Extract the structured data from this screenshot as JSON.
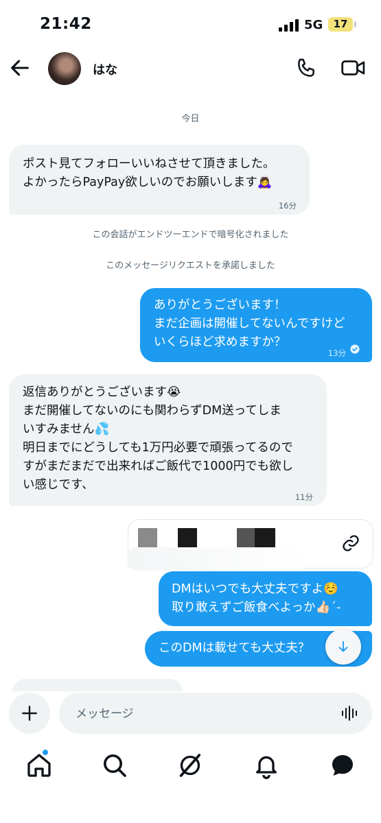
{
  "status_bar": {
    "time": "21:42",
    "network": "5G",
    "battery": "17"
  },
  "header": {
    "contact_name": "はな"
  },
  "chat": {
    "date_separator": "今日",
    "messages": [
      {
        "direction": "in",
        "text": "ポスト見てフォローいいねさせて頂きました。\nよかったらPayPay欲しいのでお願いします🙇‍♀️",
        "time": "16分"
      },
      {
        "direction": "out",
        "text": "ありがとうございます！\nまだ企画は開催してないんですけど\nいくらほど求めますか？",
        "time": "13分"
      },
      {
        "direction": "in",
        "text": "返信ありがとうございます😭\nまだ開催してないのにも関わらずDM送ってしま\nいすみません💦\n明日までにどうしても1万円必要で頑張ってるので\nすがまだまだで出来ればご飯代で1000円でも欲し\nい感じです、",
        "time": "11分"
      },
      {
        "direction": "out",
        "text": "DMはいつでも大丈夫ですよ☺️\n取り敢えずご飯食べよっか👍🏻´-"
      },
      {
        "direction": "out",
        "text": "このDMは載せても大丈夫？"
      }
    ],
    "system_notices": [
      "この会話がエンドツーエンドで暗号化されました",
      "このメッセージリクエストを承諾しました"
    ]
  },
  "composer": {
    "placeholder": "メッセージ"
  },
  "icons": {
    "back": "arrow-left-icon",
    "call": "phone-icon",
    "video": "video-camera-icon",
    "link": "link-icon",
    "scroll": "arrow-down-icon",
    "add": "plus-icon",
    "voice": "waveform-icon",
    "nav": [
      "home-icon",
      "search-icon",
      "grok-icon",
      "bell-icon",
      "messages-icon"
    ]
  },
  "colors": {
    "accent": "#1d9bf0",
    "incoming_bubble": "#eff3f4",
    "battery": "#f2e27a"
  }
}
